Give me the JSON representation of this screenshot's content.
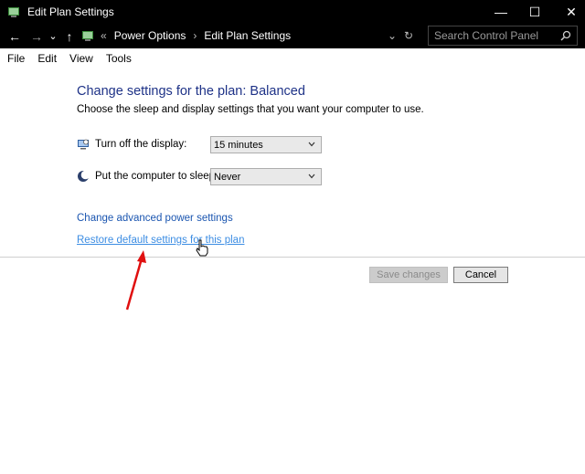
{
  "window": {
    "title": "Edit Plan Settings",
    "minimize_glyph": "—",
    "maximize_glyph": "☐",
    "close_glyph": "✕"
  },
  "nav": {
    "back_glyph": "←",
    "forward_glyph": "→",
    "recent_glyph": "⌄",
    "up_glyph": "↑",
    "breadcrumb_sep": "«",
    "crumb_sep": "›",
    "breadcrumb": [
      "Power Options",
      "Edit Plan Settings"
    ],
    "dropdown_glyph": "⌄",
    "refresh_glyph": "↻",
    "search_placeholder": "Search Control Panel"
  },
  "menu": [
    "File",
    "Edit",
    "View",
    "Tools"
  ],
  "content": {
    "heading": "Change settings for the plan: Balanced",
    "subheading": "Choose the sleep and display settings that you want your computer to use.",
    "settings": [
      {
        "label": "Turn off the display:",
        "value": "15 minutes",
        "icon": "monitor-icon"
      },
      {
        "label": "Put the computer to sleep:",
        "value": "Never",
        "icon": "moon-icon"
      }
    ],
    "link_advanced": "Change advanced power settings",
    "link_restore": "Restore default settings for this plan",
    "save_label": "Save changes",
    "cancel_label": "Cancel"
  },
  "colors": {
    "heading": "#1e3287",
    "link": "#1a55b0",
    "annotation_arrow": "#e01010"
  }
}
